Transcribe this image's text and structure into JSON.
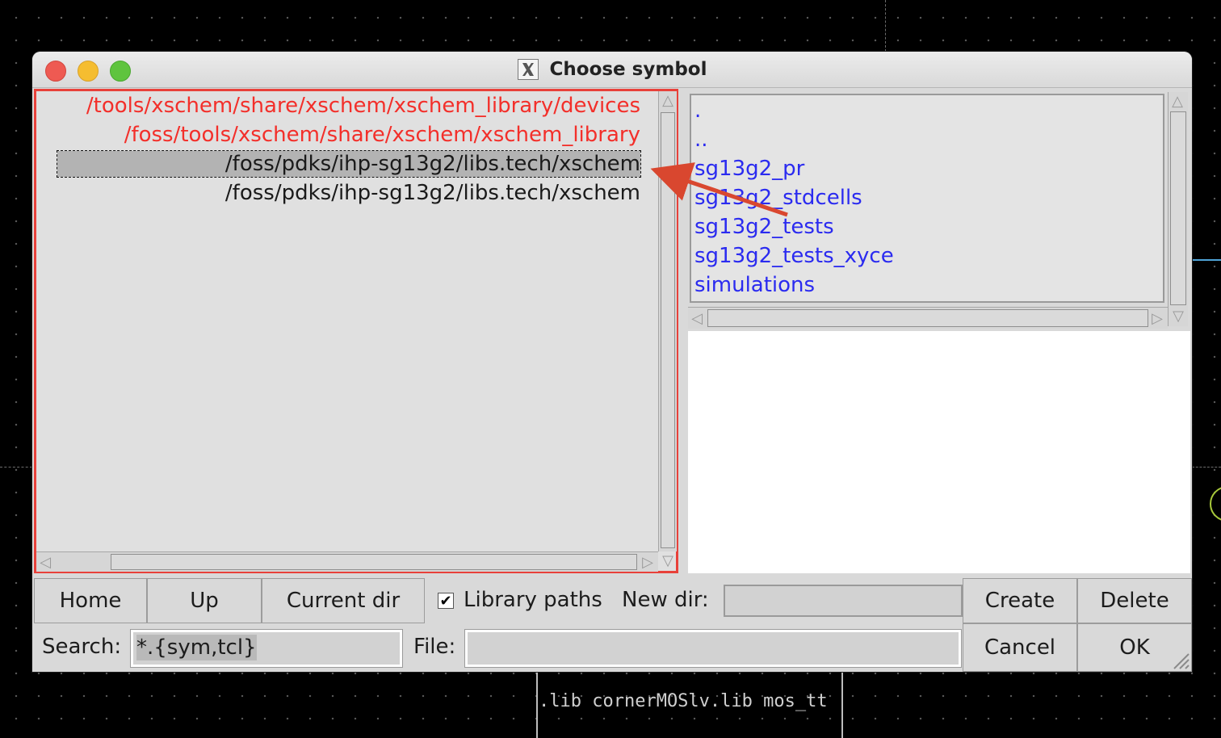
{
  "window": {
    "title": "Choose symbol"
  },
  "library_paths": [
    {
      "path": "/tools/xschem/share/xschem/xschem_library/devices",
      "color": "#f32f2a",
      "selected": false
    },
    {
      "path": "/foss/tools/xschem/share/xschem/xschem_library",
      "color": "#f32f2a",
      "selected": false
    },
    {
      "path": "/foss/pdks/ihp-sg13g2/libs.tech/xschem",
      "color": "#1a1a1a",
      "selected": true
    },
    {
      "path": "/foss/pdks/ihp-sg13g2/libs.tech/xschem",
      "color": "#1a1a1a",
      "selected": false
    }
  ],
  "file_list": [
    ".",
    "..",
    "sg13g2_pr",
    "sg13g2_stdcells",
    "sg13g2_tests",
    "sg13g2_tests_xyce",
    "simulations"
  ],
  "buttons": {
    "home": "Home",
    "up": "Up",
    "current_dir": "Current dir",
    "create": "Create",
    "delete": "Delete",
    "cancel": "Cancel",
    "ok": "OK"
  },
  "library_paths_checkbox": {
    "label": "Library paths",
    "checked": true
  },
  "new_dir": {
    "label": "New dir:",
    "value": ""
  },
  "search": {
    "label": "Search:",
    "value": "*.{sym,tcl}"
  },
  "file": {
    "label": "File:",
    "value": ""
  },
  "background_text": ".lib cornerMOSlv.lib mos_tt",
  "colors": {
    "annotation": "#e8413a",
    "file_link": "#2b2bf0",
    "library_path_red": "#f32f2a"
  }
}
